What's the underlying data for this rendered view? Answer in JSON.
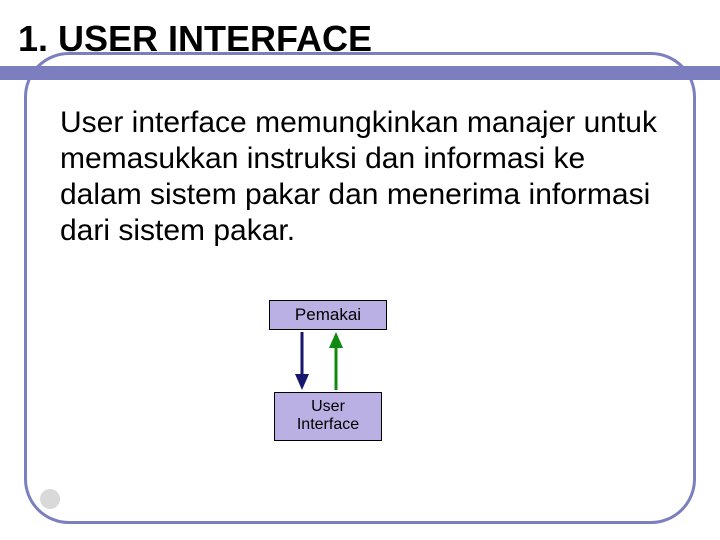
{
  "slide": {
    "title": "1.  USER INTERFACE",
    "body": "User interface memungkinkan manajer untuk memasukkan instruksi dan informasi ke dalam sistem pakar dan menerima informasi dari sistem pakar.",
    "diagram": {
      "top_box": "Pemakai",
      "bottom_box_line1": "User",
      "bottom_box_line2": "Interface"
    },
    "colors": {
      "accent": "#7c7fbf",
      "box_fill": "#bbb0e3",
      "arrow_down": "#16166f",
      "arrow_up": "#0f8a0f"
    }
  }
}
